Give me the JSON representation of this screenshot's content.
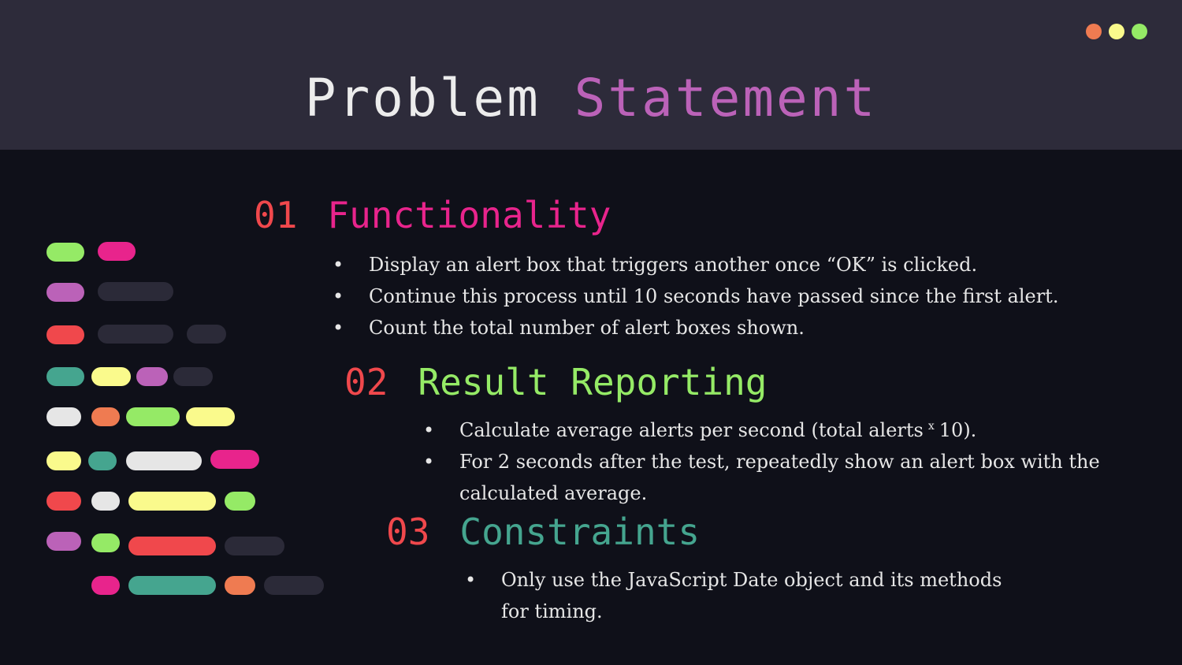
{
  "header": {
    "title_word1": "Problem",
    "title_word2": "Statement"
  },
  "colors": {
    "header_bg": "#2d2b3a",
    "body_bg": "#0f1019",
    "title_accent": "#bb62b8",
    "number": "#f0484c",
    "functionality": "#e8248c",
    "result_reporting": "#95ea66",
    "constraints": "#45a58f",
    "window_dots": [
      "#ef7b51",
      "#fafa8c",
      "#95ea66"
    ]
  },
  "sections": [
    {
      "number": "01",
      "title": "Functionality",
      "bullets": [
        "Display an alert box that triggers another once “OK” is clicked.",
        "Continue this process until 10 seconds have passed since the first alert.",
        "Count the total number of alert boxes shown."
      ]
    },
    {
      "number": "02",
      "title": "Result Reporting",
      "bullet1_a": "Calculate average alerts per second (total alerts",
      "bullet1_sup": "x",
      "bullet1_b": "10).",
      "bullet2": "For 2 seconds after the test, repeatedly show an alert box with the calculated average."
    },
    {
      "number": "03",
      "title": "Constraints",
      "bullets": [
        "Only use the JavaScript Date object and its methods for timing."
      ]
    }
  ],
  "bullet_glyph": "•"
}
